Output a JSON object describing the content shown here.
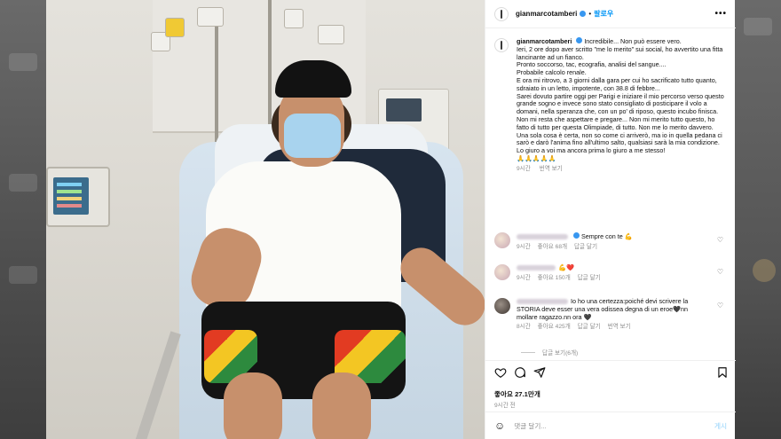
{
  "post": {
    "username": "gianmarcotamberi",
    "follow_label": "팔로우",
    "more_label": "•••",
    "separator": "•"
  },
  "caption": {
    "username": "gianmarcotamberi",
    "text": "Incredibile... Non può essere vero.\nIeri, 2 ore dopo aver scritto \"me lo merito\" sui social, ho avvertito una fitta lancinante ad un fianco.\nPronto soccorso, tac, ecografia, analisi del sangue....\nProbabile calcolo renale.\nE ora mi ritrovo, a 3 giorni dalla gara per cui ho sacrificato tutto quanto, sdraiato in un letto, impotente, con 38.8 di febbre...\nSarei dovuto partire oggi per Parigi e iniziare il mio percorso verso questo grande sogno e invece sono stato consigliato di posticipare il volo a domani, nella speranza che, con un po' di riposo, questo incubo finisca.\nNon mi resta che aspettare e pregare... Non mi merito tutto questo, ho fatto di tutto per questa Olimpiade, di tutto. Non me lo merito davvero.\nUna sola cosa è certa, non so come ci arriverò, ma io in quella pedana ci sarò e darò l'anima fino all'ultimo salto, qualsiasi sarà la mia condizione. Lo giuro a voi ma ancora prima lo giuro a me stesso!",
    "emoji": "🙏🙏🙏🙏🙏",
    "time": "9시간",
    "translate_label": "번역 보기"
  },
  "comments": [
    {
      "text": "Sempre con te 💪",
      "time": "9시간",
      "likes": "좋아요 68개",
      "reply": "답글 달기"
    },
    {
      "text": "💪❤️",
      "time": "9시간",
      "likes": "좋아요 150개",
      "reply": "답글 달기"
    },
    {
      "text": "Io ho una certezza:poiché devi scrivere la STORIA deve esser una vera odissea degna di un eroe🖤nn mollare ragazzo.nn ora 🖤",
      "time": "8시간",
      "likes": "좋아요 425개",
      "reply": "답글 달기",
      "translate": "번역 보기"
    }
  ],
  "replies_label": "답글 보기(6개)",
  "actions": {
    "like_icon": "heart-outline-icon",
    "comment_icon": "comment-bubble-icon",
    "share_icon": "paper-plane-icon",
    "save_icon": "bookmark-icon"
  },
  "likes_count": "좋아요 27.1만개",
  "time_ago": "9시간 전",
  "comment_box": {
    "placeholder": "댓글 달기...",
    "post_label": "게시"
  },
  "colors": {
    "accent": "#0095f6",
    "verified": "#3897f0",
    "muted": "#8e8e8e"
  }
}
